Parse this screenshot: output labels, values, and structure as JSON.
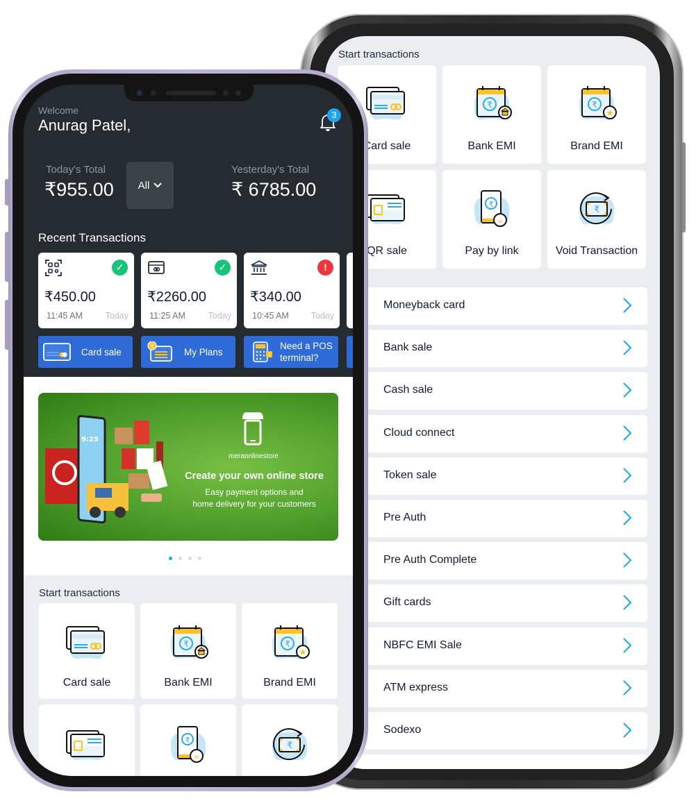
{
  "front_phone": {
    "header": {
      "welcome": "Welcome",
      "username": "Anurag Patel,",
      "notification_count": "3"
    },
    "totals": {
      "today_label": "Today's Total",
      "today_value": "₹955.00",
      "filter_label": "All",
      "yesterday_label": "Yesterday's Total",
      "yesterday_value": "₹ 6785.00"
    },
    "recent": {
      "title": "Recent Transactions",
      "items": [
        {
          "icon": "qr-scan-icon",
          "status": "success",
          "amount": "₹450.00",
          "time": "11:45 AM",
          "day": "Today"
        },
        {
          "icon": "card-icon",
          "status": "success",
          "amount": "₹2260.00",
          "time": "11:25 AM",
          "day": "Today"
        },
        {
          "icon": "bank-icon",
          "status": "failed",
          "amount": "₹340.00",
          "time": "10:45 AM",
          "day": "Today"
        }
      ]
    },
    "quick_actions": [
      {
        "label": "Card sale",
        "icon": "card-icon"
      },
      {
        "label": "My Plans",
        "icon": "plans-icon"
      },
      {
        "label": "Need a POS terminal?",
        "line1": "Need a POS",
        "line2": "terminal?",
        "icon": "pos-terminal-icon"
      }
    ],
    "banner": {
      "brand": "meraonlinestore",
      "headline": "Create your own online store",
      "sub_line1": "Easy payment options and",
      "sub_line2": "home delivery for your customers",
      "slide_count": 4,
      "active_slide": 1
    },
    "start_transactions": {
      "title": "Start transactions",
      "tiles": [
        {
          "label": "Card sale",
          "icon": "card-sale-icon"
        },
        {
          "label": "Bank EMI",
          "icon": "bank-emi-icon"
        },
        {
          "label": "Brand EMI",
          "icon": "brand-emi-icon"
        },
        {
          "label": "",
          "icon": "qr-sale-icon"
        },
        {
          "label": "",
          "icon": "pay-by-link-icon"
        },
        {
          "label": "",
          "icon": "void-transaction-icon"
        }
      ]
    }
  },
  "back_phone": {
    "start_transactions": {
      "title": "Start transactions",
      "tiles": [
        {
          "label": "Card sale",
          "icon": "card-sale-icon"
        },
        {
          "label": "Bank EMI",
          "icon": "bank-emi-icon"
        },
        {
          "label": "Brand EMI",
          "icon": "brand-emi-icon"
        },
        {
          "label": "QR sale",
          "icon": "qr-sale-icon"
        },
        {
          "label": "Pay by link",
          "icon": "pay-by-link-icon"
        },
        {
          "label": "Void Transaction",
          "icon": "void-transaction-icon"
        }
      ]
    },
    "list": [
      {
        "label": "Moneyback card"
      },
      {
        "label": "Bank sale"
      },
      {
        "label": "Cash sale"
      },
      {
        "label": "Cloud connect"
      },
      {
        "label": "Token sale"
      },
      {
        "label": "Pre Auth"
      },
      {
        "label": "Pre Auth Complete"
      },
      {
        "label": "Gift cards"
      },
      {
        "label": "NBFC EMI Sale"
      },
      {
        "label": "ATM express"
      },
      {
        "label": "Sodexo"
      }
    ]
  },
  "colors": {
    "dark_header": "#252c31",
    "primary_blue": "#2f6bd6",
    "accent_cyan": "#1ca6ee",
    "success": "#17c47a",
    "error": "#f0353f",
    "icon_yellow": "#fdc225"
  }
}
